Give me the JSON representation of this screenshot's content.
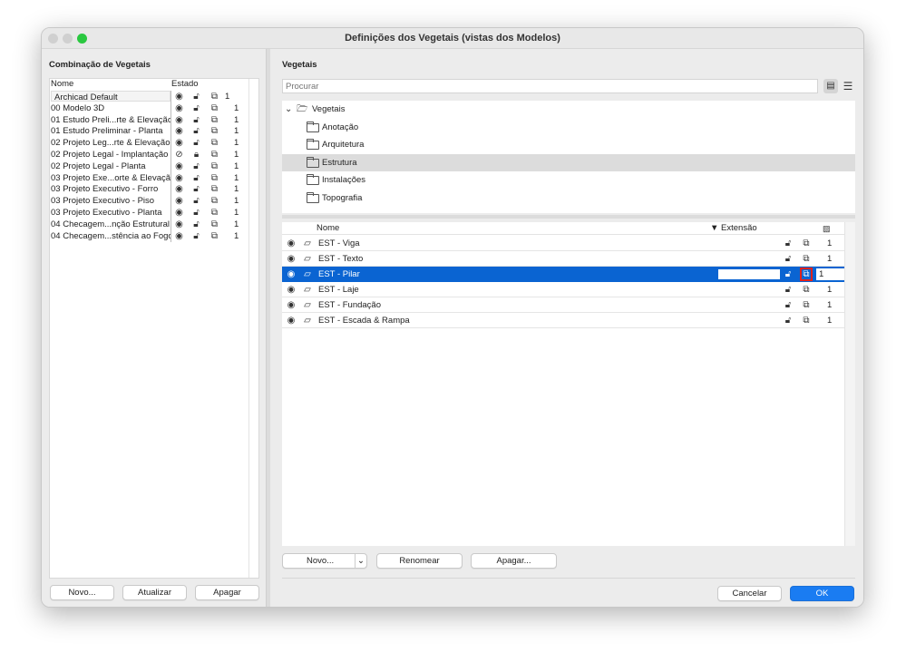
{
  "window": {
    "title": "Definições dos Vegetais (vistas dos Modelos)"
  },
  "left": {
    "title": "Combinação de Vegetais",
    "col_name": "Nome",
    "col_state": "Estado",
    "items": [
      {
        "name": "Archicad Default",
        "num": "1",
        "hidden": false
      },
      {
        "name": "00 Modelo 3D",
        "num": "1",
        "hidden": false
      },
      {
        "name": "01 Estudo Preli...rte & Elevação",
        "num": "1",
        "hidden": false
      },
      {
        "name": "01 Estudo Preliminar - Planta",
        "num": "1",
        "hidden": false
      },
      {
        "name": "02 Projeto Leg...rte & Elevação",
        "num": "1",
        "hidden": false
      },
      {
        "name": "02 Projeto Legal - Implantação",
        "num": "1",
        "hidden": true
      },
      {
        "name": "02 Projeto Legal - Planta",
        "num": "1",
        "hidden": false
      },
      {
        "name": "03 Projeto Exe...orte & Elevação",
        "num": "1",
        "hidden": false
      },
      {
        "name": "03 Projeto Executivo - Forro",
        "num": "1",
        "hidden": false
      },
      {
        "name": "03 Projeto Executivo - Piso",
        "num": "1",
        "hidden": false
      },
      {
        "name": "03 Projeto Executivo - Planta",
        "num": "1",
        "hidden": false
      },
      {
        "name": "04 Checagem...nção Estrutural",
        "num": "1",
        "hidden": false
      },
      {
        "name": "04 Checagem...stência ao Fogo",
        "num": "1",
        "hidden": false
      }
    ],
    "buttons": {
      "new": "Novo...",
      "update": "Atualizar",
      "delete": "Apagar"
    }
  },
  "right": {
    "title": "Vegetais",
    "search_placeholder": "Procurar",
    "tree": {
      "root": "Vegetais",
      "folders": [
        "Anotação",
        "Arquitetura",
        "Estrutura",
        "Instalações",
        "Topografia"
      ],
      "selected": "Estrutura"
    },
    "table": {
      "col_name": "Nome",
      "col_ext": "▼ Extensão",
      "rows": [
        {
          "name": "EST - Viga",
          "num": "1"
        },
        {
          "name": "EST - Texto",
          "num": "1"
        },
        {
          "name": "EST - Pilar",
          "num": "1",
          "selected": true
        },
        {
          "name": "EST - Laje",
          "num": "1"
        },
        {
          "name": "EST - Fundação",
          "num": "1"
        },
        {
          "name": "EST - Escada & Rampa",
          "num": "1"
        }
      ]
    },
    "buttons": {
      "new": "Novo...",
      "rename": "Renomear",
      "delete": "Apagar..."
    },
    "footer": {
      "cancel": "Cancelar",
      "ok": "OK"
    }
  },
  "colors": {
    "accent": "#0a64d2",
    "ok": "#1a7cf2",
    "highlight": "#e0231c"
  }
}
